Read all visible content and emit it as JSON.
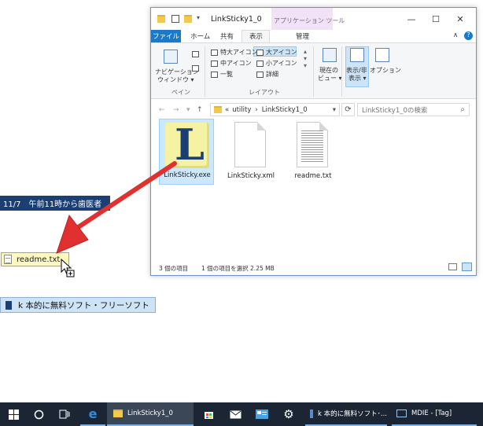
{
  "desktop": {
    "note_dentist": "11/7　午前11時から歯医者",
    "note_readme": "readme.txt",
    "note_k": "k 本的に無料ソフト・フリーソフト"
  },
  "explorer": {
    "title": "LinkSticky1_0",
    "context_tab_label": "アプリケーション ツール",
    "window_controls": {
      "minimize": "—",
      "maximize": "☐",
      "close": "✕"
    },
    "tabs": [
      "ファイル",
      "ホーム",
      "共有",
      "表示",
      "管理"
    ],
    "ribbon": {
      "pane_group": {
        "nav_label_1": "ナビゲーション",
        "nav_label_2": "ウィンドウ ▾",
        "group_label": "ペイン"
      },
      "layout_group": {
        "items": [
          "特大アイコン",
          "大アイコン",
          "中アイコン",
          "小アイコン",
          "一覧",
          "詳細"
        ],
        "group_label": "レイアウト"
      },
      "current_view_1": "現在の",
      "current_view_2": "ビュー ▾",
      "show_hide_1": "表示/非",
      "show_hide_2": "表示 ▾",
      "options": "オプション"
    },
    "address": {
      "back": "←",
      "forward": "→",
      "recent": "▾",
      "up": "↑",
      "path_prefix": "«",
      "path_1": "utility",
      "path_sep": "›",
      "path_2": "LinkSticky1_0",
      "dropdown": "▾",
      "refresh": "⟳",
      "search_placeholder": "LinkSticky1_0の検索",
      "search_icon": "⌕"
    },
    "files": [
      {
        "name": "LinkSticky.exe",
        "icon": "exe-L-icon",
        "selected": true
      },
      {
        "name": "LinkSticky.xml",
        "icon": "blank-document-icon",
        "selected": false
      },
      {
        "name": "readme.txt",
        "icon": "text-document-icon",
        "selected": false
      }
    ],
    "status": {
      "count": "3 個の項目",
      "selection": "1 個の項目を選択  2.25 MB"
    },
    "ribbon_collapse": "∧",
    "help": "?"
  },
  "taskbar": {
    "start_icon": "windows-logo-icon",
    "tasks": [
      {
        "label": "LinkSticky1_0"
      },
      {
        "label": "k 本的に無料ソフト･..."
      },
      {
        "label": "MDIE - [Tag]"
      }
    ]
  },
  "colors": {
    "accent": "#1979ca",
    "taskbar": "#1c2533",
    "drag_arrow": "#e03030",
    "note_blue": "#1b3f73",
    "note_yellow": "#fdf9c0"
  }
}
